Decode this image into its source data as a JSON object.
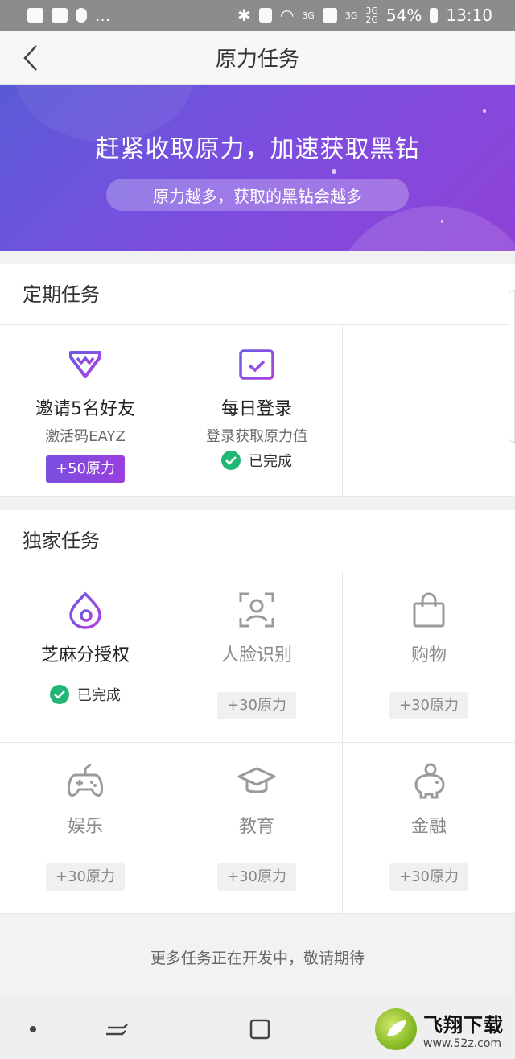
{
  "status_bar": {
    "battery_percent": "54%",
    "time": "13:10",
    "network_labels": [
      "3G",
      "3G",
      "3G",
      "2G"
    ],
    "overflow": "..."
  },
  "nav": {
    "title": "原力任务"
  },
  "banner": {
    "headline": "赶紧收取原力，加速获取黑钻",
    "subline": "原力越多，获取的黑钻会越多"
  },
  "regular": {
    "title": "定期任务",
    "items": [
      {
        "name": "邀请5名好友",
        "sub": "激活码EAYZ",
        "badge": "+50原力",
        "icon": "diamond-icon"
      },
      {
        "name": "每日登录",
        "sub": "登录获取原力值",
        "status": "已完成",
        "icon": "calendar-check-icon"
      }
    ]
  },
  "exclusive": {
    "title": "独家任务",
    "items": [
      {
        "name": "芝麻分授权",
        "status": "已完成",
        "icon": "sesame-icon"
      },
      {
        "name": "人脸识别",
        "badge": "+30原力",
        "icon": "face-scan-icon"
      },
      {
        "name": "购物",
        "badge": "+30原力",
        "icon": "shopping-bag-icon"
      },
      {
        "name": "娱乐",
        "badge": "+30原力",
        "icon": "gamepad-icon"
      },
      {
        "name": "教育",
        "badge": "+30原力",
        "icon": "graduation-cap-icon"
      },
      {
        "name": "金融",
        "badge": "+30原力",
        "icon": "piggy-bank-icon"
      }
    ]
  },
  "footer": {
    "note": "更多任务正在开发中，敬请期待"
  },
  "watermark": {
    "title": "飞翔下载",
    "url": "www.52z.com"
  },
  "colors": {
    "accent": "#8a46e0",
    "done_green": "#22b573",
    "banner_start": "#5a5ad6",
    "banner_end": "#8f42d6"
  }
}
